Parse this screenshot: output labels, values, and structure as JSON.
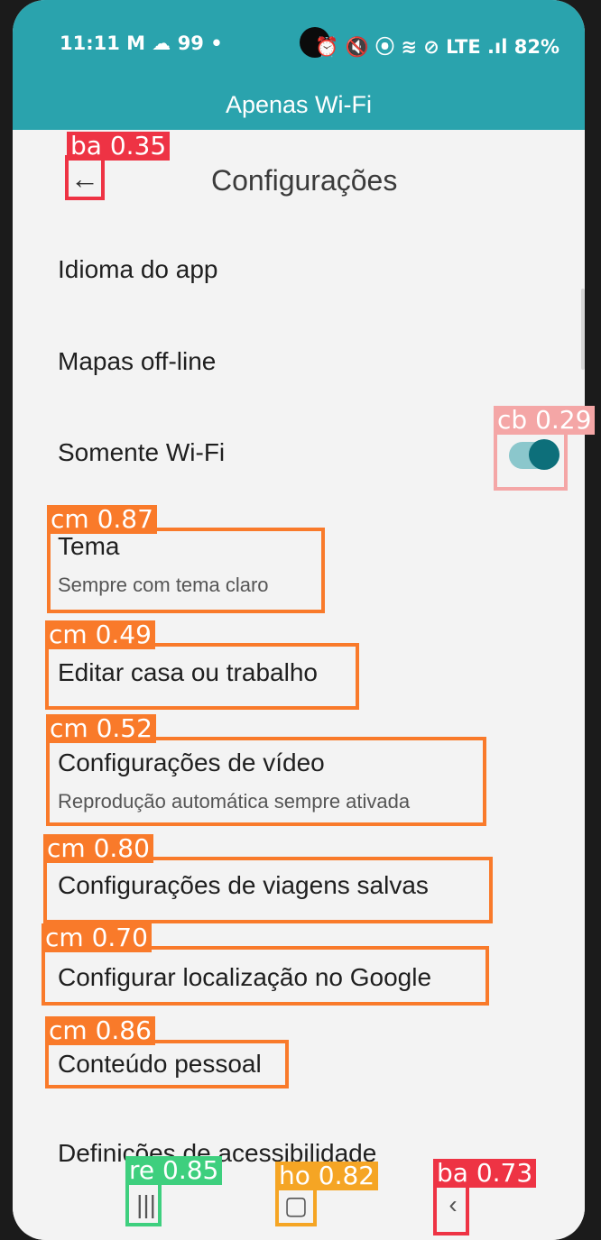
{
  "status_bar": {
    "time": "11:11",
    "left_icons": "M ☁ 99 •",
    "right_icons": "⏰ 🔇 ⦿ ≋ ⊘ LTE .ıl",
    "battery": "82%"
  },
  "banner": {
    "text": "Apenas Wi-Fi"
  },
  "header": {
    "title": "Configurações",
    "back_icon": "←"
  },
  "settings": {
    "app_language": "Idioma do app",
    "offline_maps": "Mapas off-line",
    "wifi_only": "Somente Wi-Fi",
    "theme": {
      "title": "Tema",
      "subtitle": "Sempre com tema claro"
    },
    "edit_home_work": "Editar casa ou trabalho",
    "video_settings": {
      "title": "Configurações de vídeo",
      "subtitle": "Reprodução automática sempre ativada"
    },
    "saved_trips": "Configurações de viagens salvas",
    "google_location": "Configurar localização no Google",
    "personal_content": "Conteúdo pessoal",
    "accessibility": "Definições de acessibilidade"
  },
  "nav": {
    "recents_icon": "|||",
    "home_icon": "▢",
    "back_icon": "‹"
  },
  "colors": {
    "teal": "#2aa3ad",
    "toggle_on": "#0d6f7a",
    "cm_box": "#f97a2a",
    "ba_box": "#ee3344",
    "cb_box": "#f4a6a6",
    "re_box": "#3ecf7e",
    "ho_box": "#f5a524"
  },
  "detections": {
    "back_top": "ba 0.35",
    "toggle": "cb 0.29",
    "theme": "cm 0.87",
    "edit_home": "cm 0.49",
    "video": "cm 0.52",
    "trips": "cm 0.80",
    "location": "cm 0.70",
    "personal": "cm 0.86",
    "recents": "re 0.85",
    "home": "ho 0.82",
    "back_nav": "ba 0.73"
  }
}
